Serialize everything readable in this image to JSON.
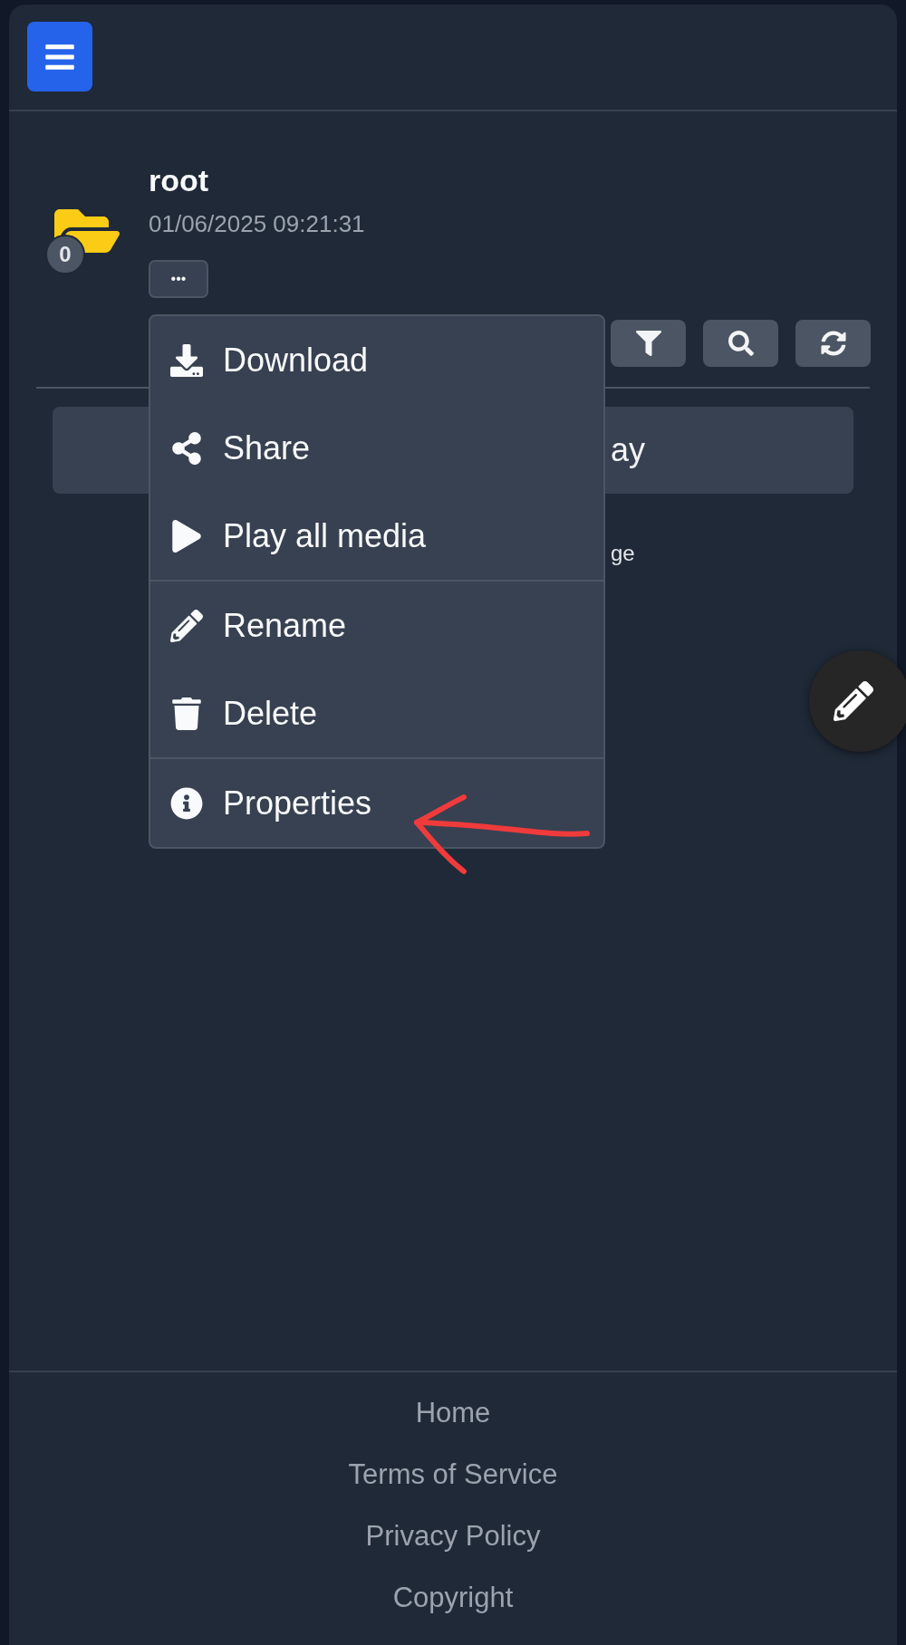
{
  "folder": {
    "name": "root",
    "date": "01/06/2025 09:21:31",
    "count": "0",
    "more_button": "•••"
  },
  "panel": {
    "text_visible": "ay"
  },
  "note_visible": "ge",
  "menu": {
    "groups": [
      [
        {
          "label": "Download"
        },
        {
          "label": "Share"
        },
        {
          "label": "Play all media"
        }
      ],
      [
        {
          "label": "Rename"
        },
        {
          "label": "Delete"
        }
      ],
      [
        {
          "label": "Properties"
        }
      ]
    ]
  },
  "footer": {
    "links": [
      "Home",
      "Terms of Service",
      "Privacy Policy",
      "Copyright"
    ]
  }
}
